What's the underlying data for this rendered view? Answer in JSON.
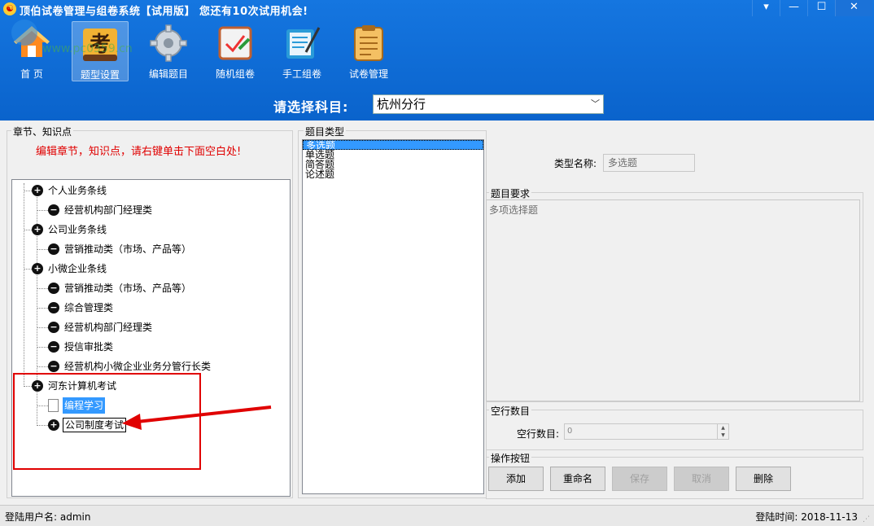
{
  "window": {
    "title": "顶伯试卷管理与组卷系统【试用版】   您还有10次试用机会!",
    "minimize_icon": "▾",
    "restore_icon": "—",
    "maximize_icon": "☐",
    "close_icon": "✕"
  },
  "toolbar": {
    "items": [
      {
        "label": "首  页",
        "icon": "home-icon",
        "color": "#ff8a1e"
      },
      {
        "label": "题型设置",
        "icon": "exam-char-icon",
        "color": "#f2b233",
        "glyph": "考"
      },
      {
        "label": "编辑题目",
        "icon": "gear-icon",
        "color": "#cfd6de"
      },
      {
        "label": "随机组卷",
        "icon": "random-paper-icon",
        "color": "#f3f3f3"
      },
      {
        "label": "手工组卷",
        "icon": "manual-paper-icon",
        "color": "#2a9bd8"
      },
      {
        "label": "试卷管理",
        "icon": "paper-manage-icon",
        "color": "#f4c063"
      }
    ],
    "active_index": 1
  },
  "subject": {
    "label": "请选择科目:",
    "value": "杭州分行"
  },
  "left_panel": {
    "group_label": "章节、知识点",
    "hint": "编辑章节，知识点，请右键单击下面空白处!",
    "tree": [
      {
        "label": "个人业务条线",
        "kind": "expand",
        "level": 0
      },
      {
        "label": "经营机构部门经理类",
        "kind": "collapse",
        "level": 1
      },
      {
        "label": "公司业务条线",
        "kind": "expand",
        "level": 0
      },
      {
        "label": "营销推动类（市场、产品等）",
        "kind": "collapse",
        "level": 1
      },
      {
        "label": "小微企业条线",
        "kind": "expand",
        "level": 0
      },
      {
        "label": "营销推动类（市场、产品等）",
        "kind": "collapse",
        "level": 1
      },
      {
        "label": "综合管理类",
        "kind": "collapse",
        "level": 1
      },
      {
        "label": "经营机构部门经理类",
        "kind": "collapse",
        "level": 1
      },
      {
        "label": "授信审批类",
        "kind": "collapse",
        "level": 1
      },
      {
        "label": "经营机构小微企业业务分管行长类",
        "kind": "collapse",
        "level": 1
      },
      {
        "label": "河东计算机考试",
        "kind": "expand",
        "level": 0
      },
      {
        "label": "编程学习",
        "kind": "doc",
        "level": 1,
        "selected": true
      },
      {
        "label": "公司制度考试",
        "kind": "expand",
        "level": 1,
        "editing": true
      }
    ]
  },
  "middle_panel": {
    "group_label": "题目类型",
    "items": [
      "多选题",
      "单选题",
      "简答题",
      "论述题"
    ],
    "selected_index": 0
  },
  "right_panel": {
    "type_name_label": "类型名称:",
    "type_name_value": "多选题",
    "requirement_group_label": "题目要求",
    "requirement_text": "多项选择题",
    "empty_lines_group_label": "空行数目",
    "empty_lines_label": "空行数目:",
    "empty_lines_value": "0",
    "ops_group_label": "操作按钮",
    "buttons": [
      {
        "label": "添加",
        "enabled": true
      },
      {
        "label": "重命名",
        "enabled": true
      },
      {
        "label": "保存",
        "enabled": false
      },
      {
        "label": "取消",
        "enabled": false
      },
      {
        "label": "删除",
        "enabled": true
      }
    ]
  },
  "status": {
    "user": "登陆用户名:  admin",
    "time": "登陆时间:  2018-11-13"
  },
  "colors": {
    "title_blue": "#1576e0",
    "hint_red": "#e00000",
    "annotation_red": "#e00000",
    "selection_blue": "#3399ff"
  },
  "watermark_text": "www.pc0359.cn"
}
